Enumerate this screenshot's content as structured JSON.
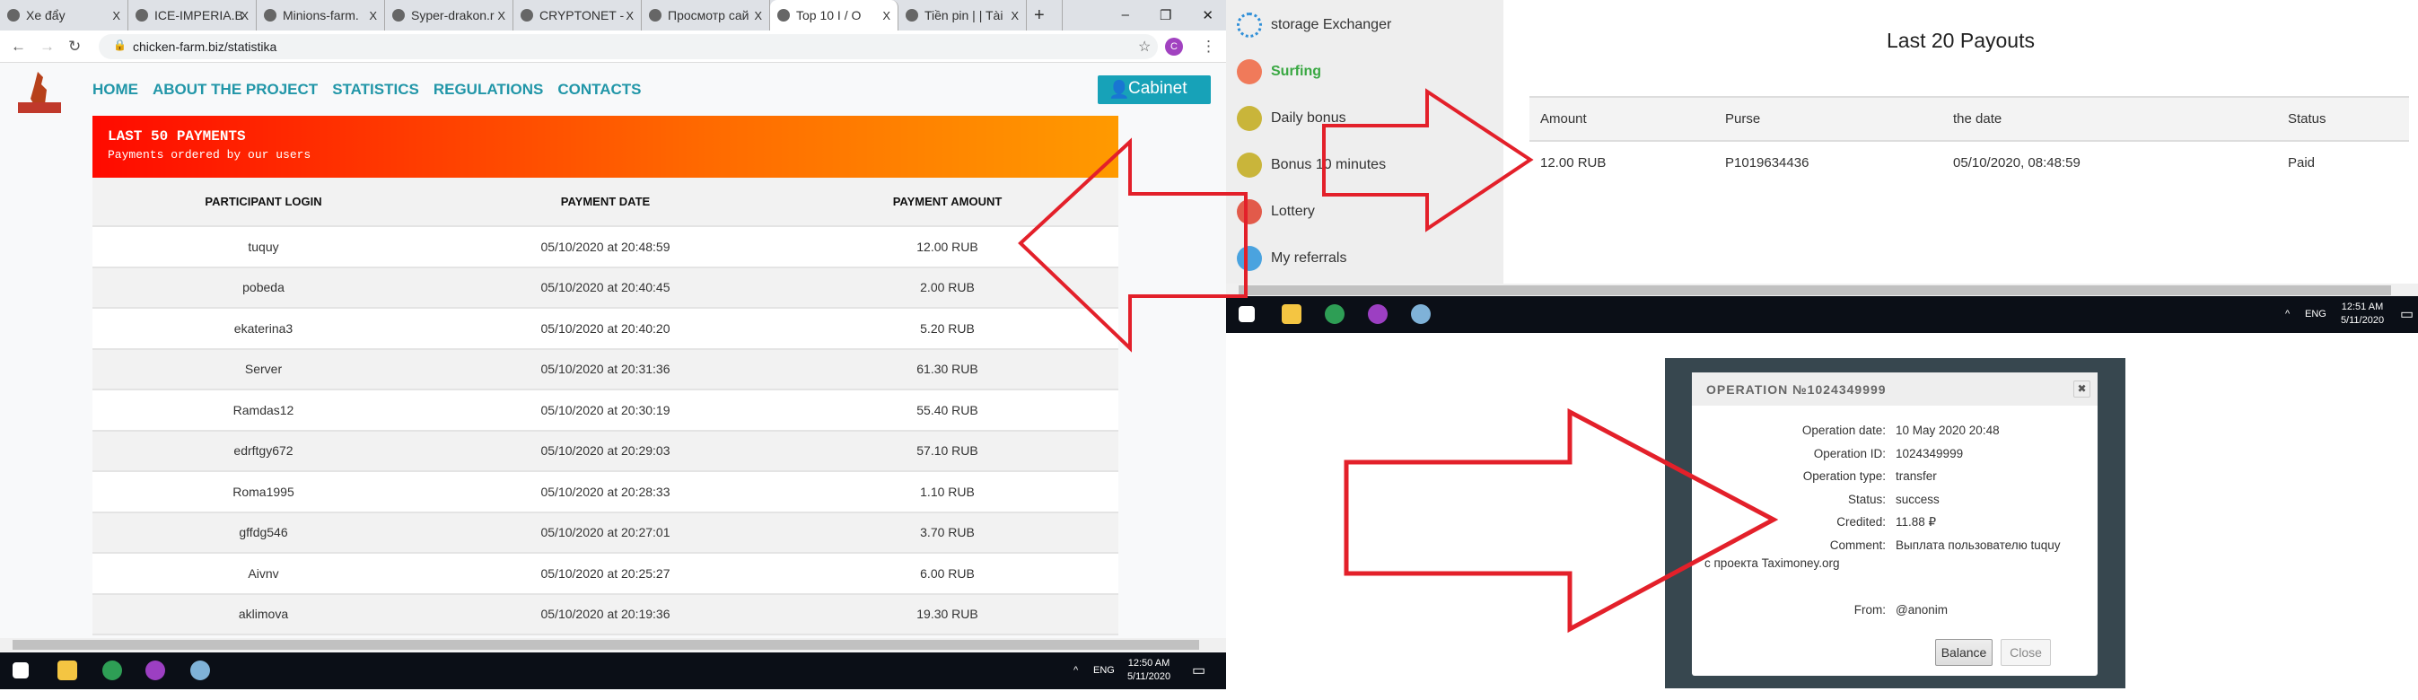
{
  "browser": {
    "tabs": [
      {
        "label": "Xe đẩy"
      },
      {
        "label": "ICE-IMPERIA.B"
      },
      {
        "label": "Minions-farm."
      },
      {
        "label": "Syper-drakon.r"
      },
      {
        "label": "CRYPTONET - "
      },
      {
        "label": "Просмотр сай"
      },
      {
        "label": "Top 10 I / O",
        "active": true
      },
      {
        "label": "Tiền pin | | Tài"
      }
    ],
    "close_glyph": "X",
    "new_tab": "+",
    "url": "chicken-farm.biz/statistika",
    "profile_initial": "C"
  },
  "site": {
    "logo_text": "CHICKEN",
    "nav": [
      "HOME",
      "ABOUT THE PROJECT",
      "STATISTICS",
      "REGULATIONS",
      "CONTACTS"
    ],
    "cabinet_label": "Cabinet",
    "banner_title": "LAST 50 PAYMENTS",
    "banner_subtitle": "Payments ordered by our users",
    "columns": [
      "PARTICIPANT LOGIN",
      "PAYMENT DATE",
      "PAYMENT AMOUNT"
    ],
    "rows": [
      [
        "tuquy",
        "05/10/2020 at 20:48:59",
        "12.00 RUB"
      ],
      [
        "pobeda",
        "05/10/2020 at 20:40:45",
        "2.00 RUB"
      ],
      [
        "ekaterina3",
        "05/10/2020 at 20:40:20",
        "5.20 RUB"
      ],
      [
        "Server",
        "05/10/2020 at 20:31:36",
        "61.30 RUB"
      ],
      [
        "Ramdas12",
        "05/10/2020 at 20:30:19",
        "55.40 RUB"
      ],
      [
        "edrftgy672",
        "05/10/2020 at 20:29:03",
        "57.10 RUB"
      ],
      [
        "Roma1995",
        "05/10/2020 at 20:28:33",
        "1.10 RUB"
      ],
      [
        "gffdg546",
        "05/10/2020 at 20:27:01",
        "3.70 RUB"
      ],
      [
        "Aivnv",
        "05/10/2020 at 20:25:27",
        "6.00 RUB"
      ],
      [
        "aklimova",
        "05/10/2020 at 20:19:36",
        "19.30 RUB"
      ]
    ]
  },
  "taskbar_left": {
    "lang": "ENG",
    "time": "12:50 AM",
    "date": "5/11/2020"
  },
  "taskbar_right": {
    "lang": "ENG",
    "time": "12:51 AM",
    "date": "5/11/2020"
  },
  "sidebar": {
    "items": [
      {
        "label": "storage Exchanger",
        "icon": "refresh-icon"
      },
      {
        "label": "Surfing",
        "icon": "laptop-icon",
        "active": true
      },
      {
        "label": "Daily bonus",
        "icon": "coin-icon"
      },
      {
        "label": "Bonus 10 minutes",
        "icon": "coin-icon"
      },
      {
        "label": "Lottery",
        "icon": "slot-777-icon"
      },
      {
        "label": "My referrals",
        "icon": "people-icon"
      }
    ]
  },
  "payouts": {
    "title": "Last 20 Payouts",
    "columns": [
      "Amount",
      "Purse",
      "the date",
      "Status"
    ],
    "rows": [
      [
        "12.00 RUB",
        "P1019634436",
        "05/10/2020, 08:48:59",
        "Paid"
      ]
    ]
  },
  "operation": {
    "title": "OPERATION №1024349999",
    "fields": [
      {
        "k": "Operation date:",
        "v": "10 May 2020 20:48"
      },
      {
        "k": "Operation ID:",
        "v": "1024349999"
      },
      {
        "k": "Operation type:",
        "v": "transfer"
      },
      {
        "k": "Status:",
        "v": "success"
      },
      {
        "k": "Credited:",
        "v": "11.88 ₽"
      },
      {
        "k": "Comment:",
        "v": "Выплата пользователю tuquy"
      }
    ],
    "comment_cont": "с проекта Taximoney.org",
    "from_label": "From:",
    "from_value": "@anonim",
    "balance_label": "Balance",
    "close_label": "Close"
  },
  "colors": {
    "accent": "#17a2b8",
    "nav": "#2196a8",
    "banner_start": "#ff0a00",
    "banner_end": "#ff9a00",
    "arrow": "#e3202a",
    "surfing": "#3aa843"
  }
}
